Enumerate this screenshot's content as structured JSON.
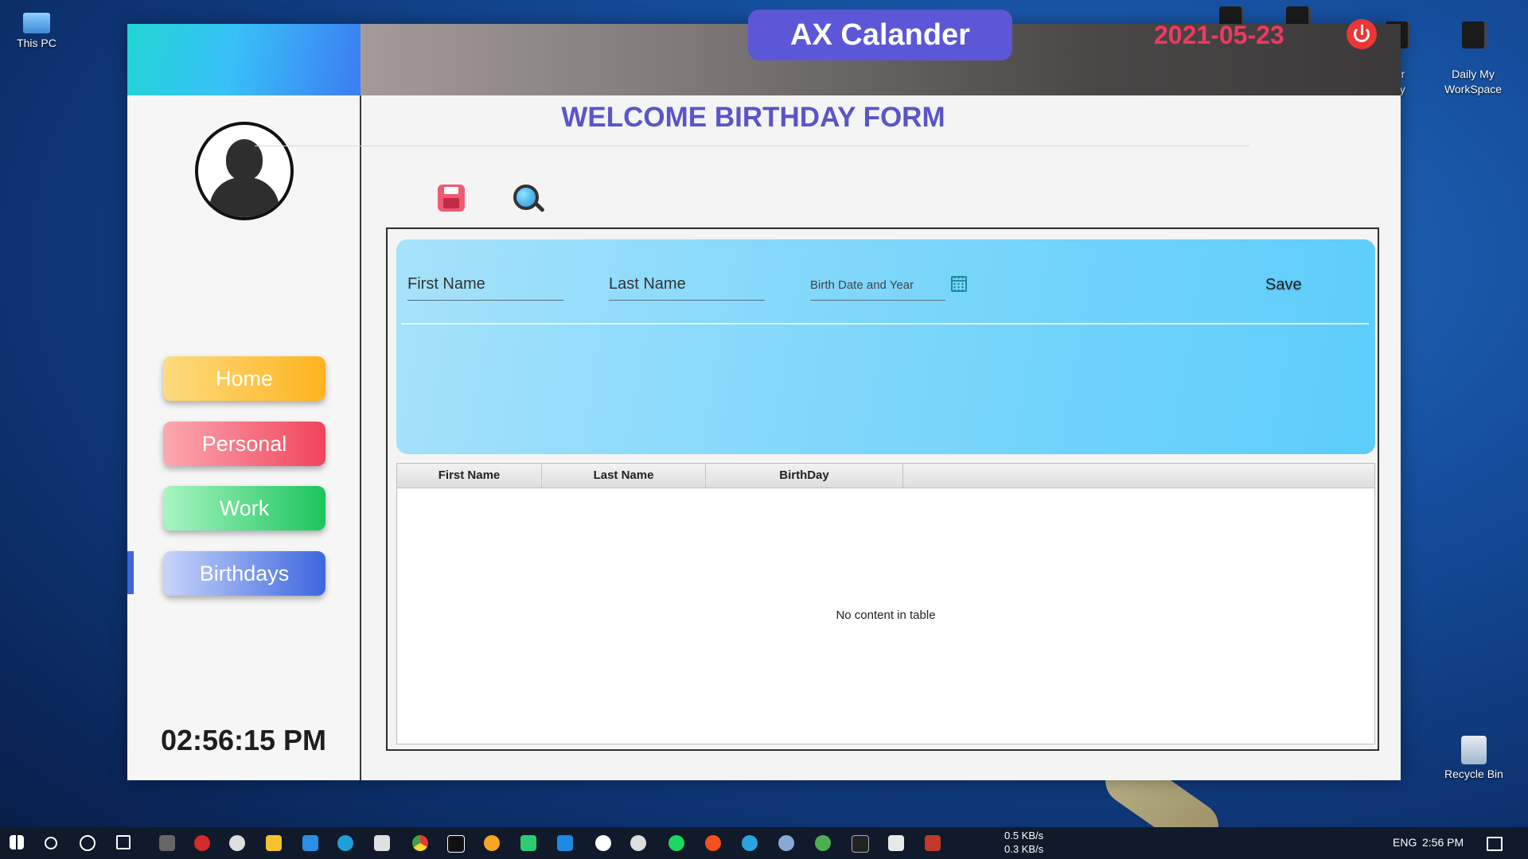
{
  "desktop": {
    "icons": [
      {
        "label": "This PC"
      },
      {
        "label": "ber\nirity"
      },
      {
        "label": "Daily My\nWorkSpace"
      },
      {
        "label": "Recycle Bin"
      }
    ]
  },
  "app": {
    "title": "AX Calander",
    "date": "2021-05-23",
    "form_title": "WELCOME BIRTHDAY FORM",
    "nav": {
      "home": "Home",
      "personal": "Personal",
      "work": "Work",
      "birthdays": "Birthdays",
      "active": "Birthdays"
    },
    "clock": "02:56:15 PM",
    "form": {
      "first_name_placeholder": "First Name",
      "last_name_placeholder": "Last Name",
      "birth_date_placeholder": "Birth Date and Year",
      "save_label": "Save"
    },
    "table": {
      "columns": [
        "First Name",
        "Last Name",
        "BirthDay"
      ],
      "rows": [],
      "empty_message": "No content in table"
    },
    "colors": {
      "title_pill": "#5b57d6",
      "date": "#ee3a5f",
      "form_title": "#5a55c8"
    }
  },
  "taskbar": {
    "net_down": "0.5 KB/s",
    "net_up": "0.3 KB/s",
    "language": "ENG",
    "time": "2:56 PM"
  }
}
